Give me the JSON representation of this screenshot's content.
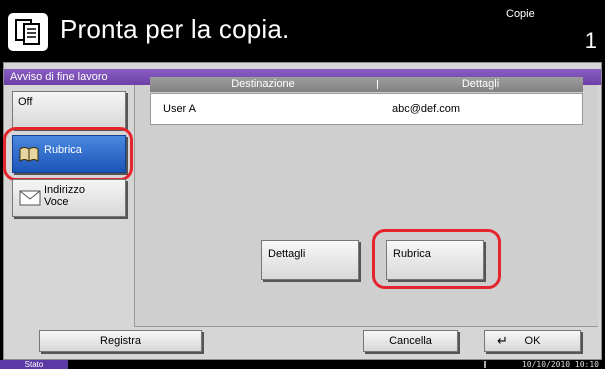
{
  "header": {
    "title": "Pronta per la copia.",
    "copies_label": "Copie",
    "copies_value": "1",
    "icon": "copier-icon"
  },
  "panel": {
    "title": "Avviso di fine lavoro",
    "options": [
      {
        "label": "Off",
        "selected": false
      },
      {
        "label": "Rubrica",
        "icon": "address-book-icon",
        "selected": true
      },
      {
        "label_line1": "Indirizzo",
        "label_line2": "Voce",
        "icon": "envelope-icon",
        "selected": false
      }
    ],
    "table": {
      "headers": [
        "Destinazione",
        "Dettagli"
      ],
      "rows": [
        {
          "destination": "User A",
          "details": "abc@def.com"
        }
      ]
    },
    "buttons": {
      "details": "Dettagli",
      "address_book": "Rubrica"
    }
  },
  "footer": {
    "register": "Registra",
    "cancel": "Cancella",
    "ok": "OK"
  },
  "status": {
    "label": "Stato",
    "datetime": "10/10/2010  10:10"
  },
  "colors": {
    "selected_button": "#1c55b8",
    "panel_title": "#6b3fa6",
    "highlight_ring": "#e5252e"
  }
}
